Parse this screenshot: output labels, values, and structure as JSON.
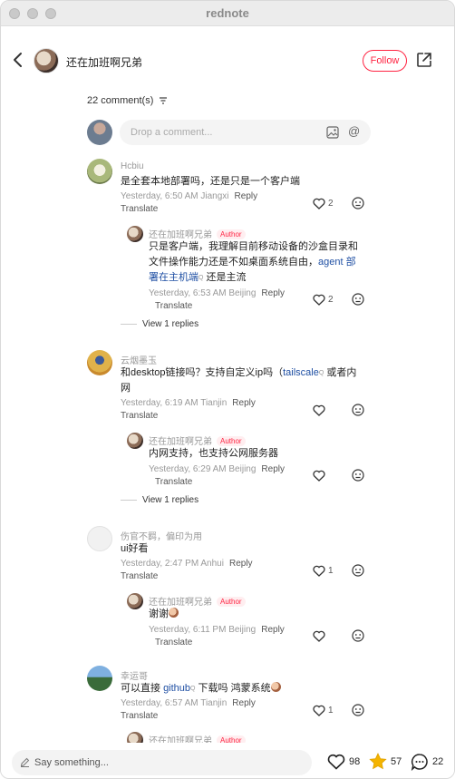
{
  "window": {
    "title": "rednote"
  },
  "header": {
    "author_name": "还在加班啊兄弟",
    "follow_label": "Follow"
  },
  "comments_header": {
    "count_label": "22 comment(s)"
  },
  "composer": {
    "placeholder": "Drop a comment..."
  },
  "comments": [
    {
      "name": "Hcbiu",
      "text": "是全套本地部署吗，还是只是一个客户端",
      "time": "Yesterday, 6:50 AM Jiangxi",
      "reply_label": "Reply",
      "translate_label": "Translate",
      "likes": "2",
      "reply": {
        "name": "还在加班啊兄弟",
        "badge": "Author",
        "text_a": "只是客户端，我理解目前移动设备的沙盒目录和文件操作能力还是不如桌面系统自由，",
        "link": "agent 部署在主机端",
        "text_b": " 还是主流",
        "time": "Yesterday, 6:53 AM Beijing",
        "reply_label": "Reply",
        "translate_label": "Translate",
        "likes": "2"
      },
      "view_replies": "View 1 replies"
    },
    {
      "name": "云烟墨玉",
      "text_a": "和desktop链接吗？支持自定义ip吗（",
      "link": "tailscale",
      "text_b": " 或者内网",
      "time": "Yesterday, 6:19 AM Tianjin",
      "reply_label": "Reply",
      "translate_label": "Translate",
      "reply": {
        "name": "还在加班啊兄弟",
        "badge": "Author",
        "text": "内网支持，也支持公网服务器",
        "time": "Yesterday, 6:29 AM Beijing",
        "reply_label": "Reply",
        "translate_label": "Translate"
      },
      "view_replies": "View 1 replies"
    },
    {
      "name": "伤官不羁，偏印为用",
      "text": "ui好看",
      "time": "Yesterday, 2:47 PM Anhui",
      "reply_label": "Reply",
      "translate_label": "Translate",
      "likes": "1",
      "reply": {
        "name": "还在加班啊兄弟",
        "badge": "Author",
        "text": "谢谢",
        "time": "Yesterday, 6:11 PM Beijing",
        "reply_label": "Reply",
        "translate_label": "Translate"
      }
    },
    {
      "name": "幸运哥",
      "text_a": "可以直接 ",
      "link": "github",
      "text_b": " 下载吗 鸿蒙系统",
      "time": "Yesterday, 6:57 AM Tianjin",
      "reply_label": "Reply",
      "translate_label": "Translate",
      "likes": "1",
      "reply": {
        "name": "还在加班啊兄弟",
        "badge": "Author"
      }
    }
  ],
  "bottom_bar": {
    "placeholder": "Say something...",
    "likes": "98",
    "stars": "57",
    "comments": "22"
  },
  "colors": {
    "accent": "#ff2442",
    "link": "#1f4fa3",
    "star": "#f4b400"
  }
}
